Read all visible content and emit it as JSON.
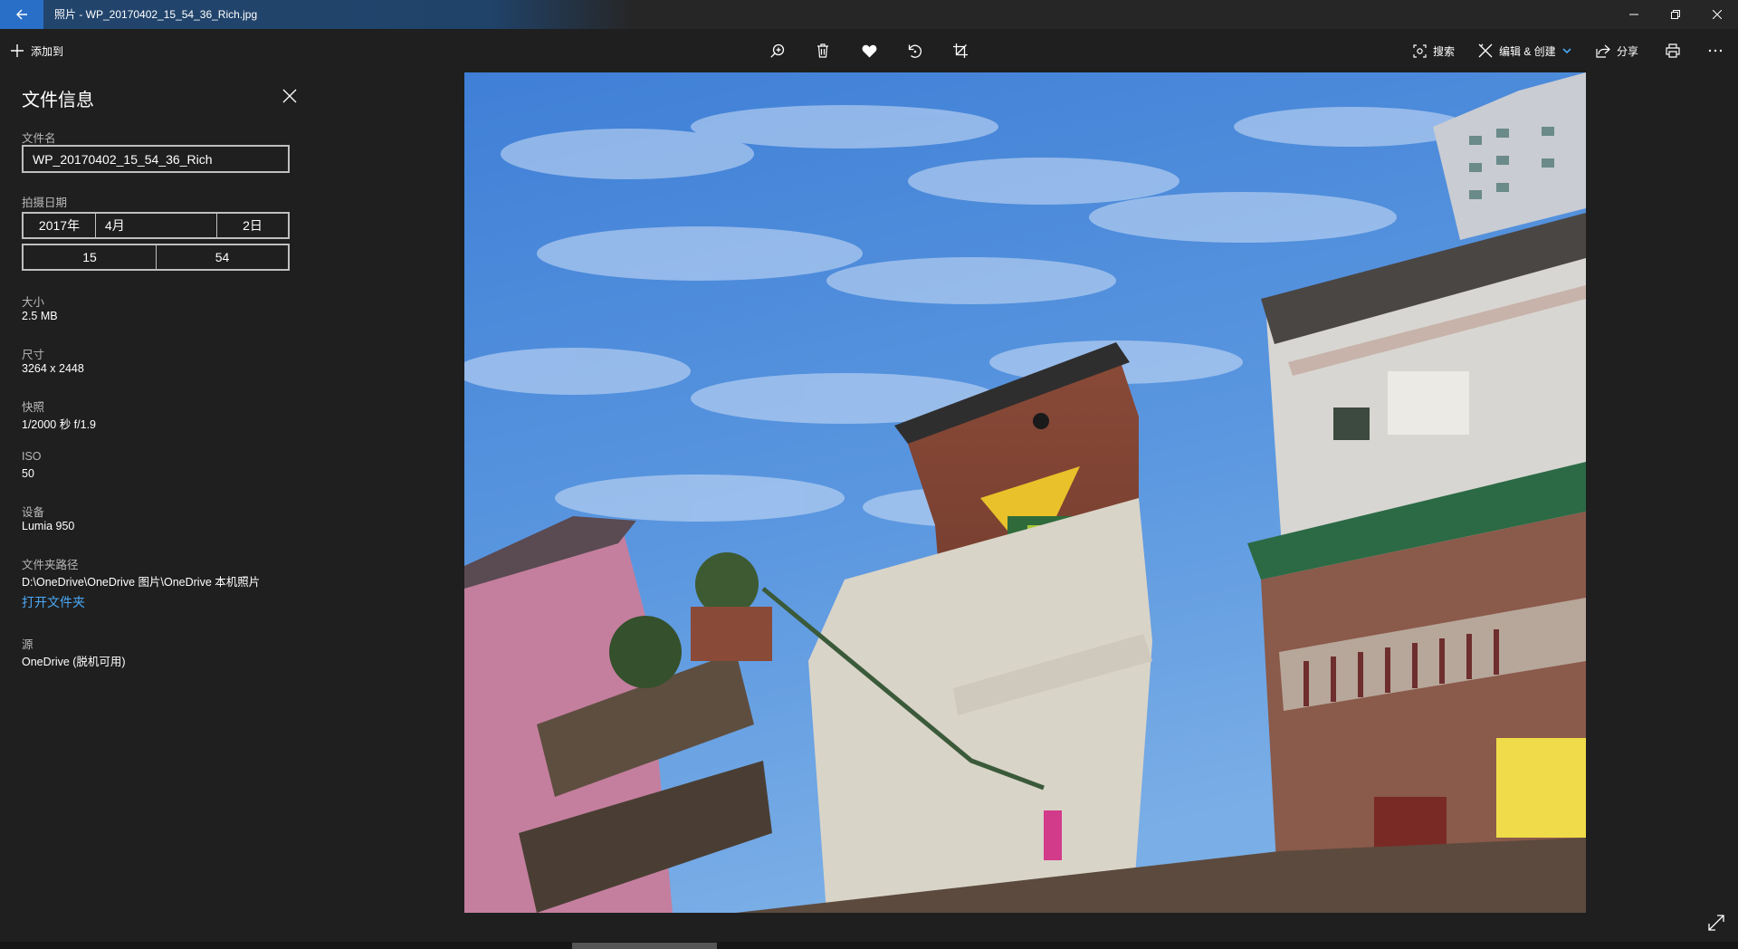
{
  "window": {
    "title": "照片 - WP_20170402_15_54_36_Rich.jpg"
  },
  "toolbar": {
    "add_label": "添加到",
    "tools": [
      "zoom-icon",
      "delete-icon",
      "favorite-icon",
      "rotate-icon",
      "crop-icon"
    ],
    "search_label": "搜索",
    "edit_label": "编辑 & 创建",
    "share_label": "分享"
  },
  "info": {
    "title": "文件信息",
    "filename_label": "文件名",
    "filename_value": "WP_20170402_15_54_36_Rich",
    "date_label": "拍摄日期",
    "date_year": "2017年",
    "date_month": "4月",
    "date_day": "2日",
    "time_hour": "15",
    "time_minute": "54",
    "size_label": "大小",
    "size_value": "2.5 MB",
    "dimensions_label": "尺寸",
    "dimensions_value": "3264 x 2448",
    "shutter_label": "快照",
    "shutter_value": "1/2000 秒 f/1.9",
    "iso_label": "ISO",
    "iso_value": "50",
    "device_label": "设备",
    "device_value": "Lumia 950",
    "folder_label": "文件夹路径",
    "folder_value": "D:\\OneDrive\\OneDrive 图片\\OneDrive 本机照片",
    "open_folder_link": "打开文件夹",
    "source_label": "源",
    "source_value": "OneDrive (脱机可用)"
  },
  "colors": {
    "accent": "#2a6fc7",
    "link": "#4aa8f5",
    "background": "#1f1f1f"
  }
}
